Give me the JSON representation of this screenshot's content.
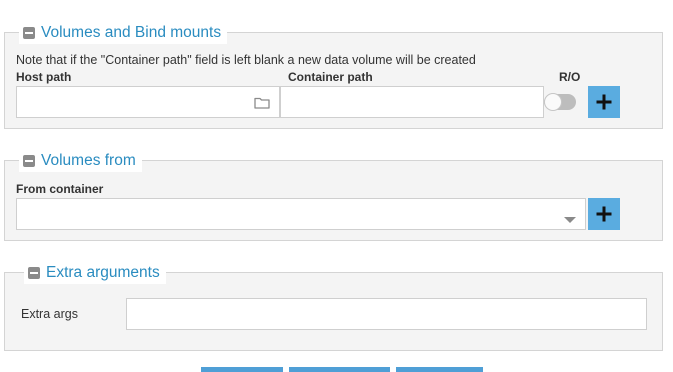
{
  "volumes_section": {
    "legend": "Volumes and Bind mounts",
    "note": "Note that if the \"Container path\" field is left blank a new data volume will be created",
    "host_path_label": "Host path",
    "container_path_label": "Container path",
    "ro_label": "R/O",
    "host_path_value": "",
    "container_path_value": "",
    "ro_enabled": false,
    "folder_icon": "folder-icon",
    "add_icon": "plus-icon"
  },
  "volumes_from_section": {
    "legend": "Volumes from",
    "from_container_label": "From container",
    "from_container_value": "",
    "dropdown_icon": "caret-down-icon",
    "add_icon": "plus-icon"
  },
  "extra_args_section": {
    "legend": "Extra arguments",
    "extra_args_label": "Extra args",
    "extra_args_value": ""
  },
  "colors": {
    "accent": "#2a8cc0",
    "button": "#5aace0",
    "panel": "#f4f4f4",
    "border": "#d4d4d4"
  }
}
